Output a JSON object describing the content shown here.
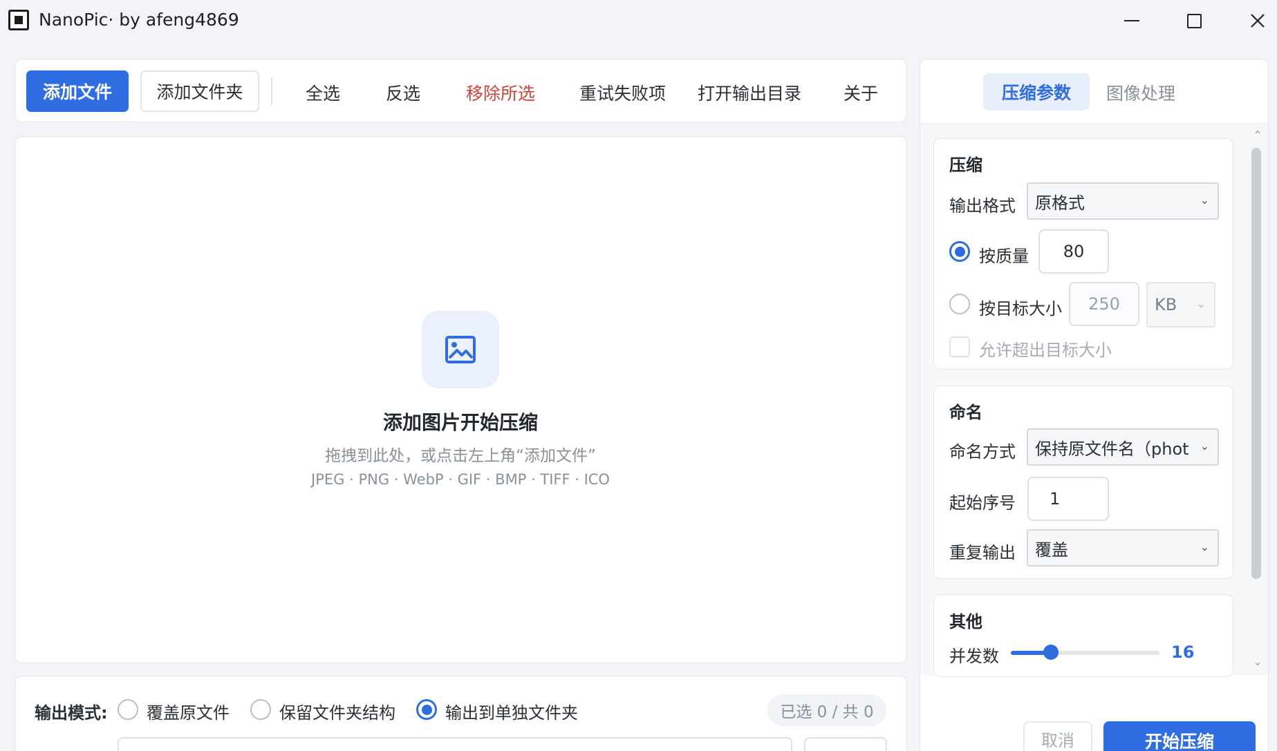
{
  "window": {
    "title": "NanoPic· by afeng4869"
  },
  "toolbar": {
    "add_file": "添加文件",
    "add_folder": "添加文件夹",
    "select_all": "全选",
    "invert_selection": "反选",
    "remove_selected": "移除所选",
    "retry_failed": "重试失败项",
    "open_output": "打开输出目录",
    "about": "关于"
  },
  "dropzone": {
    "icon": "image-icon",
    "title": "添加图片开始压缩",
    "subtitle": "拖拽到此处，或点击左上角“添加文件”",
    "formats": "JPEG · PNG · WebP · GIF · BMP · TIFF · ICO"
  },
  "output": {
    "mode_label": "输出模式:",
    "options": [
      "覆盖原文件",
      "保留文件夹结构",
      "输出到单独文件夹"
    ],
    "selected_option": "输出到单独文件夹",
    "count": "已选 0 / 共 0"
  },
  "right_panel": {
    "tabs": [
      "压缩参数",
      "图像处理"
    ],
    "active_tab": "压缩参数",
    "compress": {
      "title": "压缩",
      "format_label": "输出格式",
      "format_value": "原格式",
      "by_quality_label": "按质量",
      "quality_value": "80",
      "by_size_label": "按目标大小",
      "size_value": "250",
      "size_unit": "KB",
      "allow_exceed_label": "允许超出目标大小",
      "mode": "按质量"
    },
    "naming": {
      "title": "命名",
      "method_label": "命名方式",
      "method_value": "保持原文件名（phot",
      "start_index_label": "起始序号",
      "start_index_value": "1",
      "duplicate_label": "重复输出",
      "duplicate_value": "覆盖"
    },
    "other": {
      "title": "其他",
      "concurrency_label": "并发数",
      "concurrency_value": "16",
      "concurrency_fraction": 0.27
    }
  },
  "footer": {
    "cancel": "取消",
    "start": "开始压缩"
  },
  "colors": {
    "accent": "#2f6de1",
    "danger": "#d0453a",
    "muted": "#8a909a"
  }
}
